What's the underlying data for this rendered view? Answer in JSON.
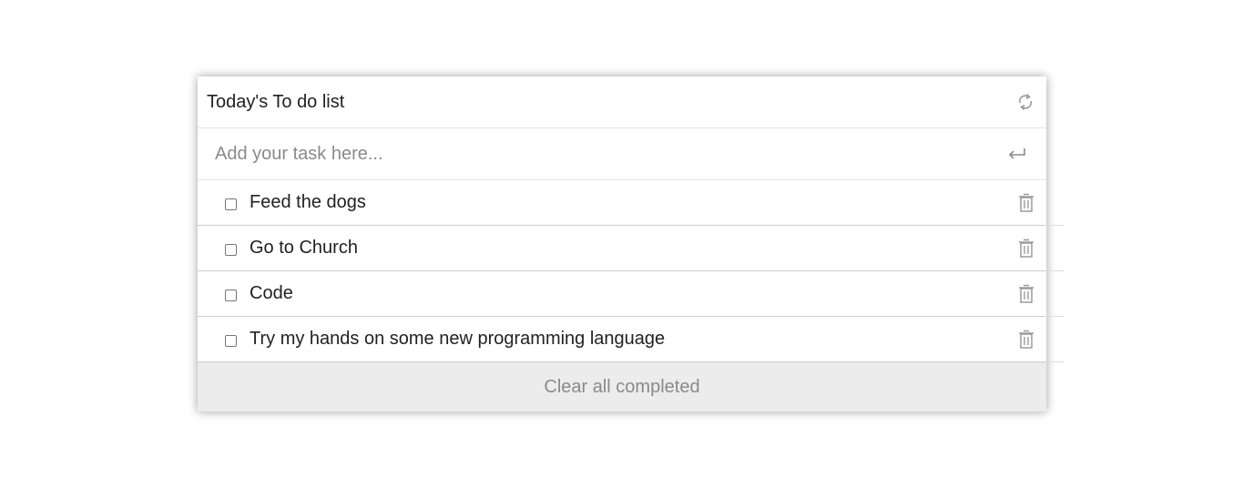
{
  "header": {
    "title": "Today's To do list",
    "refresh_icon": "refresh-icon"
  },
  "input": {
    "placeholder": "Add your task here...",
    "value": "",
    "submit_icon": "enter-icon"
  },
  "tasks": [
    {
      "label": "Feed the dogs",
      "completed": false,
      "delete_icon": "trash-icon"
    },
    {
      "label": "Go to Church",
      "completed": false,
      "delete_icon": "trash-icon"
    },
    {
      "label": "Code",
      "completed": false,
      "delete_icon": "trash-icon"
    },
    {
      "label": "Try my hands on some new programming language",
      "completed": false,
      "delete_icon": "trash-icon"
    }
  ],
  "footer": {
    "clear_label": "Clear all completed"
  },
  "colors": {
    "text": "#222222",
    "muted": "#8a8a8a",
    "icon": "#9a9a9a",
    "footer_bg": "#ececed"
  }
}
